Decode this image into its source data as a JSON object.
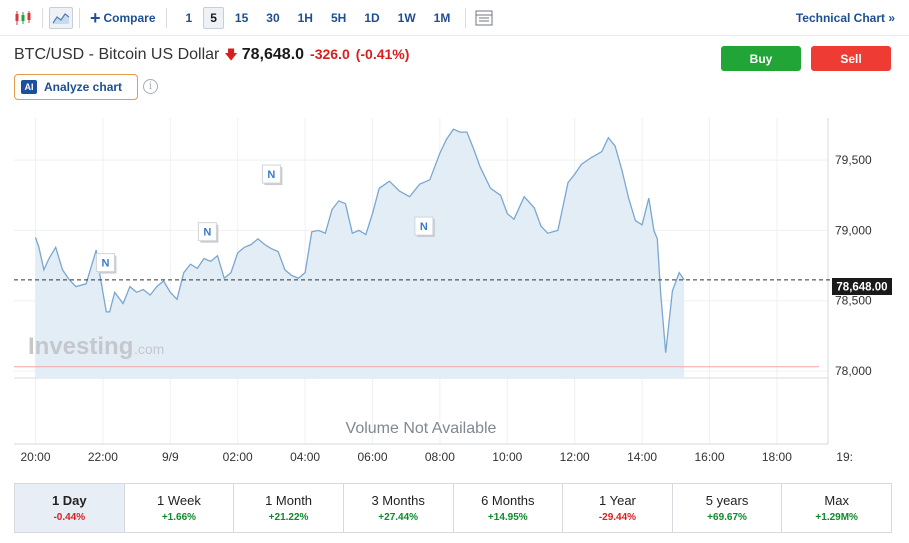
{
  "toolbar": {
    "compare_label": "Compare",
    "intervals": [
      "1",
      "5",
      "15",
      "30",
      "1H",
      "5H",
      "1D",
      "1W",
      "1M"
    ],
    "active_interval": "5",
    "technical_chart_label": "Technical Chart »"
  },
  "instrument": {
    "name": "BTC/USD - Bitcoin US Dollar",
    "price": "78,648.0",
    "change": "-326.0",
    "change_pct": "(-0.41%)",
    "direction": "down"
  },
  "actions": {
    "buy_label": "Buy",
    "sell_label": "Sell",
    "analyze_label": "Analyze chart",
    "ai_badge": "AI"
  },
  "chart": {
    "watermark_main": "Investing",
    "watermark_sub": ".com",
    "volume_message": "Volume Not Available",
    "current_price_label": "78,648.00",
    "news_marker": "N",
    "colors": {
      "line": "#7aa7d0",
      "fill": "#e3edf6",
      "price_label_bg": "#1a1a1a",
      "reference_line": "#f2a5a5"
    }
  },
  "chart_data": {
    "type": "area",
    "x_ticks": [
      "20:00",
      "22:00",
      "9/9",
      "02:00",
      "04:00",
      "06:00",
      "08:00",
      "10:00",
      "12:00",
      "14:00",
      "16:00",
      "18:00",
      "19:"
    ],
    "y_ticks": [
      78000,
      78500,
      79000,
      79500
    ],
    "y_tick_labels": [
      "78,000",
      "78,500",
      "79,000",
      "79,500"
    ],
    "ylim": [
      77950,
      79800
    ],
    "current_price": 78648,
    "reference_level": 78030,
    "x_hours": [
      0,
      0.1,
      0.25,
      0.4,
      0.6,
      0.8,
      1.0,
      1.2,
      1.5,
      1.8,
      1.9,
      2.0,
      2.1,
      2.2,
      2.35,
      2.6,
      2.8,
      3.0,
      3.2,
      3.4,
      3.6,
      3.8,
      4.0,
      4.2,
      4.4,
      4.6,
      4.8,
      5.0,
      5.2,
      5.4,
      5.6,
      5.8,
      6.0,
      6.2,
      6.4,
      6.6,
      6.8,
      7.0,
      7.2,
      7.4,
      7.6,
      7.8,
      8.0,
      8.2,
      8.4,
      8.6,
      8.8,
      9.0,
      9.2,
      9.4,
      9.6,
      9.8,
      10.0,
      10.2,
      10.5,
      10.8,
      11.1,
      11.4,
      11.7,
      12.0,
      12.2,
      12.4,
      12.6,
      12.8,
      13.0,
      13.2,
      13.5,
      13.8,
      14.0,
      14.2,
      14.5,
      14.8,
      15.0,
      15.2,
      15.5,
      15.8,
      16.0,
      16.2,
      16.5,
      16.8,
      17.0,
      17.2,
      17.4,
      17.6,
      17.8,
      18.0,
      18.2,
      18.35,
      18.45,
      18.55,
      18.7,
      18.9,
      19.1,
      19.25
    ],
    "y_values": [
      78950,
      78880,
      78720,
      78800,
      78880,
      78720,
      78650,
      78600,
      78620,
      78860,
      78700,
      78560,
      78420,
      78420,
      78560,
      78480,
      78600,
      78560,
      78580,
      78540,
      78600,
      78640,
      78560,
      78510,
      78700,
      78760,
      78730,
      78800,
      78780,
      78820,
      78660,
      78700,
      78840,
      78880,
      78900,
      78940,
      78900,
      78870,
      78850,
      78720,
      78680,
      78660,
      78700,
      78990,
      79000,
      78980,
      79150,
      79210,
      79190,
      78980,
      79000,
      78970,
      79120,
      79300,
      79350,
      79280,
      79240,
      79330,
      79360,
      79550,
      79650,
      79720,
      79700,
      79700,
      79580,
      79450,
      79300,
      79250,
      79120,
      79080,
      79240,
      79160,
      79030,
      78980,
      79000,
      79340,
      79400,
      79470,
      79520,
      79560,
      79660,
      79600,
      79430,
      79230,
      79070,
      79040,
      79230,
      79000,
      78940,
      78560,
      78130,
      78570,
      78700,
      78648
    ],
    "news_markers_x": [
      4.15,
      10.2,
      14.0,
      23.05
    ],
    "news_markers_price": [
      78700,
      78920,
      79330,
      78960
    ]
  },
  "periods": [
    {
      "label": "1 Day",
      "change": "-0.44%",
      "sign": "neg",
      "active": true
    },
    {
      "label": "1 Week",
      "change": "+1.66%",
      "sign": "pos",
      "active": false
    },
    {
      "label": "1 Month",
      "change": "+21.22%",
      "sign": "pos",
      "active": false
    },
    {
      "label": "3 Months",
      "change": "+27.44%",
      "sign": "pos",
      "active": false
    },
    {
      "label": "6 Months",
      "change": "+14.95%",
      "sign": "pos",
      "active": false
    },
    {
      "label": "1 Year",
      "change": "-29.44%",
      "sign": "neg",
      "active": false
    },
    {
      "label": "5 years",
      "change": "+69.67%",
      "sign": "pos",
      "active": false
    },
    {
      "label": "Max",
      "change": "+1.29M%",
      "sign": "pos",
      "active": false
    }
  ]
}
